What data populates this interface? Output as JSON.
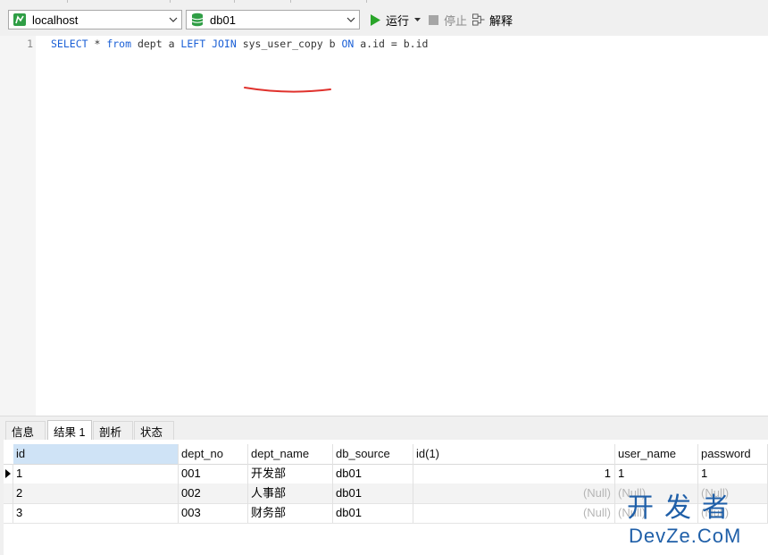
{
  "toolbar": {
    "connection": "localhost",
    "database": "db01",
    "run_label": "运行",
    "stop_label": "停止",
    "explain_label": "解释"
  },
  "editor": {
    "line_number": "1",
    "tokens": {
      "kw_select": "SELECT",
      "star": " * ",
      "kw_from": "from",
      "t1": " dept a ",
      "kw_left": "LEFT",
      "sp1": " ",
      "kw_join": "JOIN",
      "t2": " sys_user_copy b ",
      "kw_on": "ON",
      "t3": " a.id = b.id"
    },
    "annotation_color": "#e0322d"
  },
  "tabs": [
    {
      "label": "信息"
    },
    {
      "label": "结果 1"
    },
    {
      "label": "剖析"
    },
    {
      "label": "状态"
    }
  ],
  "grid": {
    "columns": [
      "id",
      "dept_no",
      "dept_name",
      "db_source",
      "id(1)",
      "user_name",
      "password"
    ],
    "rows": [
      [
        "1",
        "001",
        "开发部",
        "db01",
        "1",
        "1",
        "1"
      ],
      [
        "2",
        "002",
        "人事部",
        "db01",
        "(Null)",
        "(Null)",
        "(Null)"
      ],
      [
        "3",
        "003",
        "财务部",
        "db01",
        "(Null)",
        "(Null)",
        "(Null)"
      ]
    ]
  },
  "watermark": {
    "big": "开发者",
    "small": "DevZe.CoM"
  },
  "colors": {
    "keyword": "#1a5fd6",
    "run_green": "#2aa52a",
    "db_green": "#2f9e45",
    "selected_header": "#cfe3f6",
    "null_text": "#b5b5b5"
  },
  "icons": {
    "connection": "mysql-connection-icon",
    "database": "database-icon",
    "run": "play-icon",
    "stop": "stop-icon",
    "explain": "explain-icon"
  }
}
